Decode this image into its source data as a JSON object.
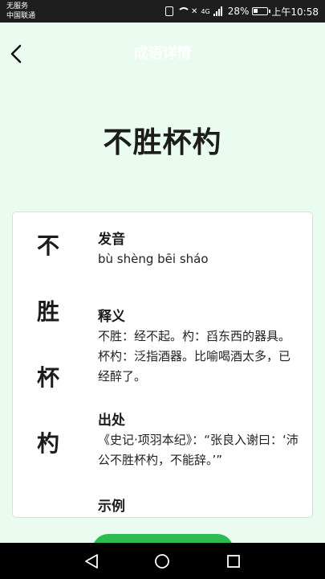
{
  "status_bar": {
    "carrier_line1": "无服务",
    "carrier_line2": "中国联通",
    "network": "4G",
    "battery": "28%",
    "time": "上午10:58"
  },
  "header": {
    "title": "成语详情"
  },
  "idiom": {
    "text": "不胜杯杓",
    "chars": [
      "不",
      "胜",
      "杯",
      "杓"
    ]
  },
  "sections": {
    "pronunciation": {
      "title": "发音",
      "text": "bù shèng bēi sháo"
    },
    "definition": {
      "title": "释义",
      "text": "不胜：经不起。杓：舀东西的器具。杯杓：泛指酒器。比喻喝酒太多，已经醉了。"
    },
    "source": {
      "title": "出处",
      "text": "《史记·项羽本纪》：“张良入谢曰：‘沛公不胜杯杓，不能辞。’”"
    },
    "example": {
      "title": "示例"
    }
  },
  "colors": {
    "background": "#eafbef",
    "accent": "#2dbb55"
  }
}
